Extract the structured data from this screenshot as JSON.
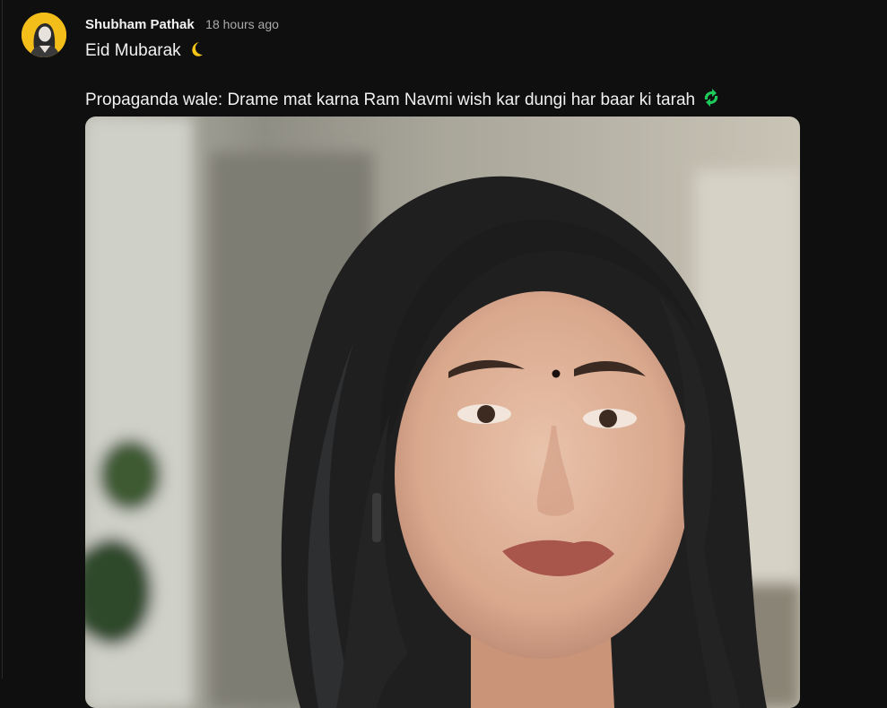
{
  "post": {
    "author": "Shubham Pathak",
    "timestamp": "18 hours ago",
    "line1": "Eid Mubarak",
    "line1_emoji": "crescent-moon-icon",
    "line2": "Propaganda wale: Drame mat karna Ram Navmi wish kar dungi har baar ki tarah",
    "line2_emoji": "recycle-arrows-icon",
    "image": "portrait-photo"
  },
  "colors": {
    "background": "#0f0f0f",
    "text": "#f1f1f1",
    "muted": "#aaaaaa",
    "avatar_bg": "#f3bd1a"
  }
}
